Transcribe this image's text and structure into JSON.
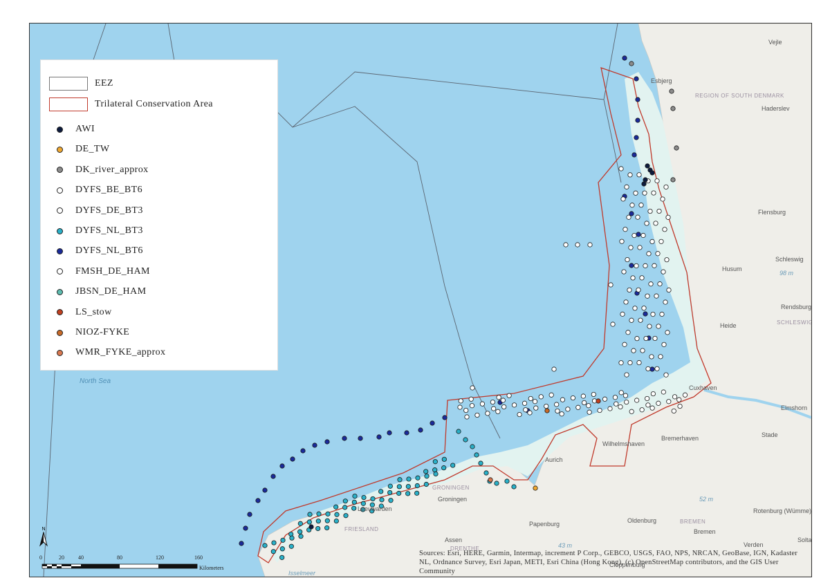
{
  "legend": {
    "eez_label": "EEZ",
    "tca_label": "Trilateral Conservation Area",
    "items": [
      {
        "label": "AWI",
        "color": "#0d1b3d"
      },
      {
        "label": "DE_TW",
        "color": "#f0a830"
      },
      {
        "label": "DK_river_approx",
        "color": "#8c8c8c"
      },
      {
        "label": "DYFS_BE_BT6",
        "color": "#ffffff"
      },
      {
        "label": "DYFS_DE_BT3",
        "color": "#ffffff"
      },
      {
        "label": "DYFS_NL_BT3",
        "color": "#2ab0c8"
      },
      {
        "label": "DYFS_NL_BT6",
        "color": "#1a2a9a"
      },
      {
        "label": "FMSH_DE_HAM",
        "color": "#ffffff"
      },
      {
        "label": "JBSN_DE_HAM",
        "color": "#5fbcb0"
      },
      {
        "label": "LS_stow",
        "color": "#c04020"
      },
      {
        "label": "NIOZ-FYKE",
        "color": "#c86a28"
      },
      {
        "label": "WMR_FYKE_approx",
        "color": "#d97850"
      }
    ]
  },
  "places": {
    "esbjerg": "Esbjerg",
    "vejle": "Vejle",
    "region_south_denmark": "REGION OF SOUTH DENMARK",
    "haderslev": "Haderslev",
    "flensburg": "Flensburg",
    "schleswig": "Schleswig",
    "husum": "Husum",
    "rendsburg": "Rendsburg",
    "schleswig_holstein": "SCHLESWIG- HOLSTEIN",
    "heide": "Heide",
    "cuxhaven": "Cuxhaven",
    "elmshorn": "Elmshorn",
    "stade": "Stade",
    "bremerhaven": "Bremerhaven",
    "wilhelmshaven": "Wilhelmshaven",
    "aurich": "Aurich",
    "groningen_prov": "GRONINGEN",
    "groningen": "Groningen",
    "leeuwarden": "Leeuwarden",
    "friesland": "FRIESLAND",
    "assen": "Assen",
    "drenthe": "DRENTHE",
    "papenburg": "Papenburg",
    "oldenburg": "Oldenburg",
    "bremen_region": "BREMEN",
    "bremen": "Bremen",
    "verden": "Verden",
    "soltau": "Solta",
    "rotenburg": "Rotenburg (Wümme)",
    "cloppenburg": "Cloppenburg",
    "north_sea": "North Sea",
    "ijsselmeer": "Isselmeer",
    "depth_98": "98 m",
    "depth_52": "52 m",
    "depth_43": "43 m"
  },
  "north_arrow": "N",
  "scale": {
    "ticks": [
      "0",
      "20",
      "40",
      "80",
      "120",
      "160"
    ],
    "unit": "Kilometers"
  },
  "attribution": "Sources: Esri, HERE, Garmin, Intermap, increment P Corp., GEBCO, USGS, FAO, NPS, NRCAN, GeoBase, IGN, Kadaster NL, Ordnance Survey, Esri Japan, METI, Esri China (Hong Kong), (c) OpenStreetMap contributors, and the GIS User Community",
  "colors": {
    "sea": "#9fd3ee",
    "land": "#efeee9",
    "tca_outline": "#c0392b",
    "wadden": "#e6f4f1",
    "eez_line": "#5a6470"
  }
}
